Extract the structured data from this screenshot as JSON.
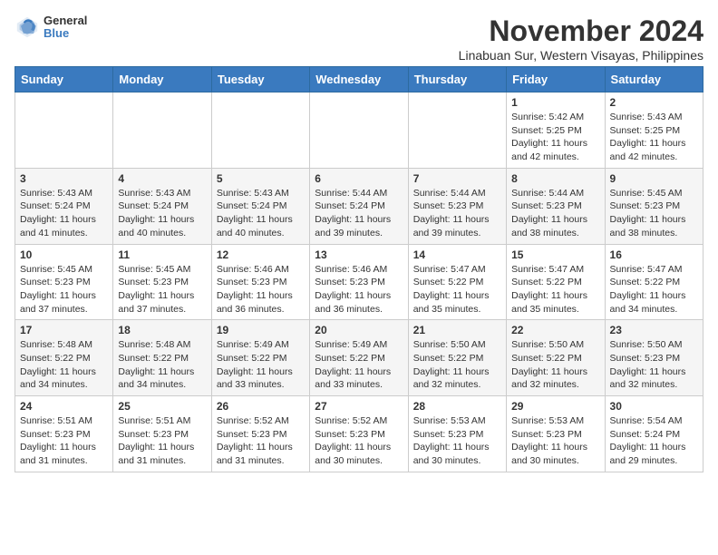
{
  "header": {
    "logo": {
      "general": "General",
      "blue": "Blue"
    },
    "month": "November 2024",
    "location": "Linabuan Sur, Western Visayas, Philippines"
  },
  "weekdays": [
    "Sunday",
    "Monday",
    "Tuesday",
    "Wednesday",
    "Thursday",
    "Friday",
    "Saturday"
  ],
  "weeks": [
    [
      {
        "day": "",
        "info": ""
      },
      {
        "day": "",
        "info": ""
      },
      {
        "day": "",
        "info": ""
      },
      {
        "day": "",
        "info": ""
      },
      {
        "day": "",
        "info": ""
      },
      {
        "day": "1",
        "info": "Sunrise: 5:42 AM\nSunset: 5:25 PM\nDaylight: 11 hours and 42 minutes."
      },
      {
        "day": "2",
        "info": "Sunrise: 5:43 AM\nSunset: 5:25 PM\nDaylight: 11 hours and 42 minutes."
      }
    ],
    [
      {
        "day": "3",
        "info": "Sunrise: 5:43 AM\nSunset: 5:24 PM\nDaylight: 11 hours and 41 minutes."
      },
      {
        "day": "4",
        "info": "Sunrise: 5:43 AM\nSunset: 5:24 PM\nDaylight: 11 hours and 40 minutes."
      },
      {
        "day": "5",
        "info": "Sunrise: 5:43 AM\nSunset: 5:24 PM\nDaylight: 11 hours and 40 minutes."
      },
      {
        "day": "6",
        "info": "Sunrise: 5:44 AM\nSunset: 5:24 PM\nDaylight: 11 hours and 39 minutes."
      },
      {
        "day": "7",
        "info": "Sunrise: 5:44 AM\nSunset: 5:23 PM\nDaylight: 11 hours and 39 minutes."
      },
      {
        "day": "8",
        "info": "Sunrise: 5:44 AM\nSunset: 5:23 PM\nDaylight: 11 hours and 38 minutes."
      },
      {
        "day": "9",
        "info": "Sunrise: 5:45 AM\nSunset: 5:23 PM\nDaylight: 11 hours and 38 minutes."
      }
    ],
    [
      {
        "day": "10",
        "info": "Sunrise: 5:45 AM\nSunset: 5:23 PM\nDaylight: 11 hours and 37 minutes."
      },
      {
        "day": "11",
        "info": "Sunrise: 5:45 AM\nSunset: 5:23 PM\nDaylight: 11 hours and 37 minutes."
      },
      {
        "day": "12",
        "info": "Sunrise: 5:46 AM\nSunset: 5:23 PM\nDaylight: 11 hours and 36 minutes."
      },
      {
        "day": "13",
        "info": "Sunrise: 5:46 AM\nSunset: 5:23 PM\nDaylight: 11 hours and 36 minutes."
      },
      {
        "day": "14",
        "info": "Sunrise: 5:47 AM\nSunset: 5:22 PM\nDaylight: 11 hours and 35 minutes."
      },
      {
        "day": "15",
        "info": "Sunrise: 5:47 AM\nSunset: 5:22 PM\nDaylight: 11 hours and 35 minutes."
      },
      {
        "day": "16",
        "info": "Sunrise: 5:47 AM\nSunset: 5:22 PM\nDaylight: 11 hours and 34 minutes."
      }
    ],
    [
      {
        "day": "17",
        "info": "Sunrise: 5:48 AM\nSunset: 5:22 PM\nDaylight: 11 hours and 34 minutes."
      },
      {
        "day": "18",
        "info": "Sunrise: 5:48 AM\nSunset: 5:22 PM\nDaylight: 11 hours and 34 minutes."
      },
      {
        "day": "19",
        "info": "Sunrise: 5:49 AM\nSunset: 5:22 PM\nDaylight: 11 hours and 33 minutes."
      },
      {
        "day": "20",
        "info": "Sunrise: 5:49 AM\nSunset: 5:22 PM\nDaylight: 11 hours and 33 minutes."
      },
      {
        "day": "21",
        "info": "Sunrise: 5:50 AM\nSunset: 5:22 PM\nDaylight: 11 hours and 32 minutes."
      },
      {
        "day": "22",
        "info": "Sunrise: 5:50 AM\nSunset: 5:22 PM\nDaylight: 11 hours and 32 minutes."
      },
      {
        "day": "23",
        "info": "Sunrise: 5:50 AM\nSunset: 5:23 PM\nDaylight: 11 hours and 32 minutes."
      }
    ],
    [
      {
        "day": "24",
        "info": "Sunrise: 5:51 AM\nSunset: 5:23 PM\nDaylight: 11 hours and 31 minutes."
      },
      {
        "day": "25",
        "info": "Sunrise: 5:51 AM\nSunset: 5:23 PM\nDaylight: 11 hours and 31 minutes."
      },
      {
        "day": "26",
        "info": "Sunrise: 5:52 AM\nSunset: 5:23 PM\nDaylight: 11 hours and 31 minutes."
      },
      {
        "day": "27",
        "info": "Sunrise: 5:52 AM\nSunset: 5:23 PM\nDaylight: 11 hours and 30 minutes."
      },
      {
        "day": "28",
        "info": "Sunrise: 5:53 AM\nSunset: 5:23 PM\nDaylight: 11 hours and 30 minutes."
      },
      {
        "day": "29",
        "info": "Sunrise: 5:53 AM\nSunset: 5:23 PM\nDaylight: 11 hours and 30 minutes."
      },
      {
        "day": "30",
        "info": "Sunrise: 5:54 AM\nSunset: 5:24 PM\nDaylight: 11 hours and 29 minutes."
      }
    ]
  ]
}
